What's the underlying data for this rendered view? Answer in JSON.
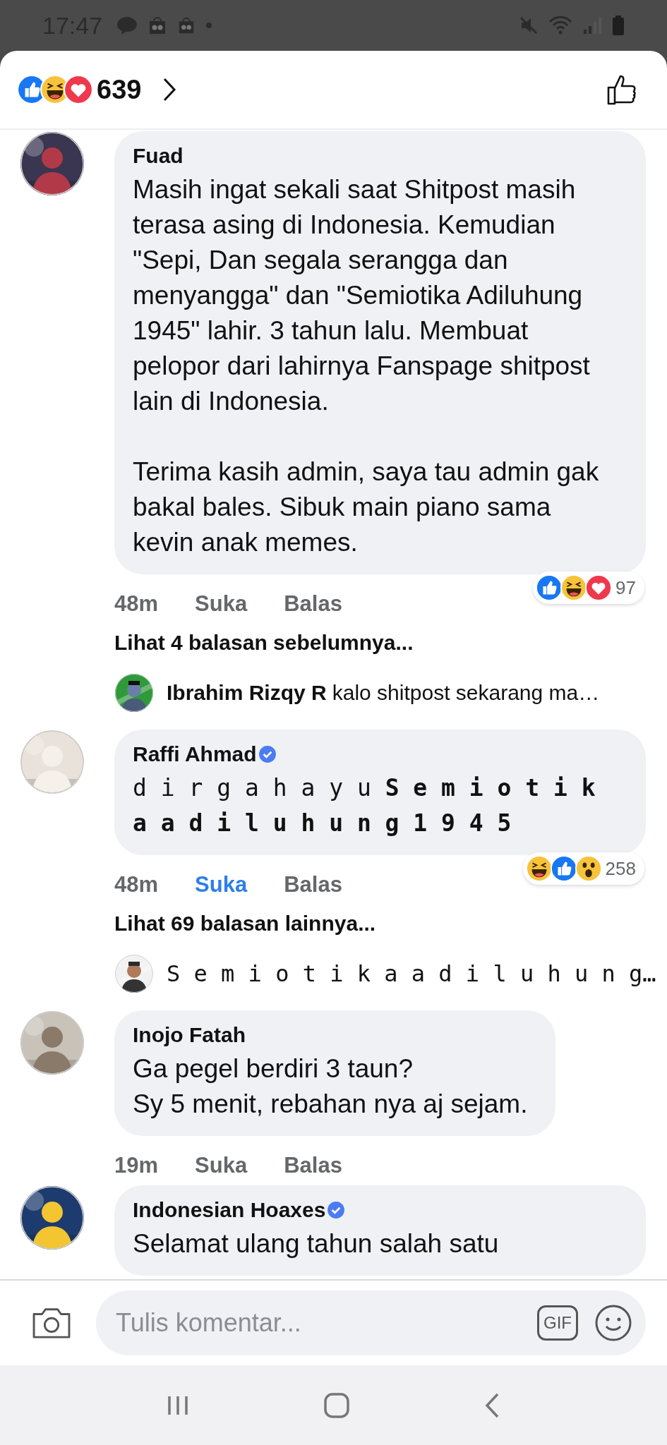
{
  "status_bar": {
    "time": "17:47"
  },
  "header": {
    "reactions": [
      {
        "kind": "like"
      },
      {
        "kind": "haha"
      },
      {
        "kind": "love"
      }
    ],
    "count": "639"
  },
  "comments": [
    {
      "author": "Fuad",
      "verified": false,
      "kind": "text",
      "paragraphs": [
        "Masih ingat sekali saat Shitpost masih terasa asing di Indonesia. Kemudian \"Sepi, Dan segala serangga dan menyangga\" dan \"Semiotika Adiluhung 1945\" lahir. 3 tahun lalu. Membuat pelopor dari lahirnya Fanspage shitpost lain di Indonesia.",
        "Terima kasih admin, saya tau admin gak bakal bales. Sibuk main piano sama kevin anak memes."
      ],
      "time": "48m",
      "like_label": "Suka",
      "liked": false,
      "reply_label": "Balas",
      "reactions": [
        {
          "kind": "like"
        },
        {
          "kind": "haha"
        },
        {
          "kind": "love"
        }
      ],
      "reaction_count": "97",
      "more_replies": "Lihat 4 balasan sebelumnya...",
      "reply_preview": {
        "author": "Ibrahim Rizqy R",
        "text": "kalo shitpost sekarang ma…",
        "kind": "text"
      }
    },
    {
      "author": "Raffi Ahmad",
      "verified": true,
      "kind": "spaced",
      "paragraphs": [
        "d i r g a h a y u **S e m i o t i k a a d i l u h u n g 1 9 4 5**"
      ],
      "time": "48m",
      "like_label": "Suka",
      "liked": true,
      "reply_label": "Balas",
      "reactions": [
        {
          "kind": "haha"
        },
        {
          "kind": "like"
        },
        {
          "kind": "wow"
        }
      ],
      "reaction_count": "258",
      "more_replies": "Lihat 69 balasan lainnya...",
      "reply_preview": {
        "text": "S e m i o t i k a a d i l u h u n g…",
        "kind": "spaced"
      }
    },
    {
      "author": "Inojo Fatah",
      "verified": false,
      "kind": "text",
      "paragraphs": [
        "Ga pegel berdiri 3 taun?\nSy 5 menit, rebahan nya aj sejam."
      ],
      "time": "19m",
      "like_label": "Suka",
      "liked": false,
      "reply_label": "Balas"
    },
    {
      "author": "Indonesian Hoaxes",
      "verified": true,
      "kind": "text",
      "paragraphs": [
        "Selamat ulang tahun salah satu"
      ]
    }
  ],
  "composer": {
    "placeholder": "Tulis komentar...",
    "gif_label": "GIF"
  }
}
